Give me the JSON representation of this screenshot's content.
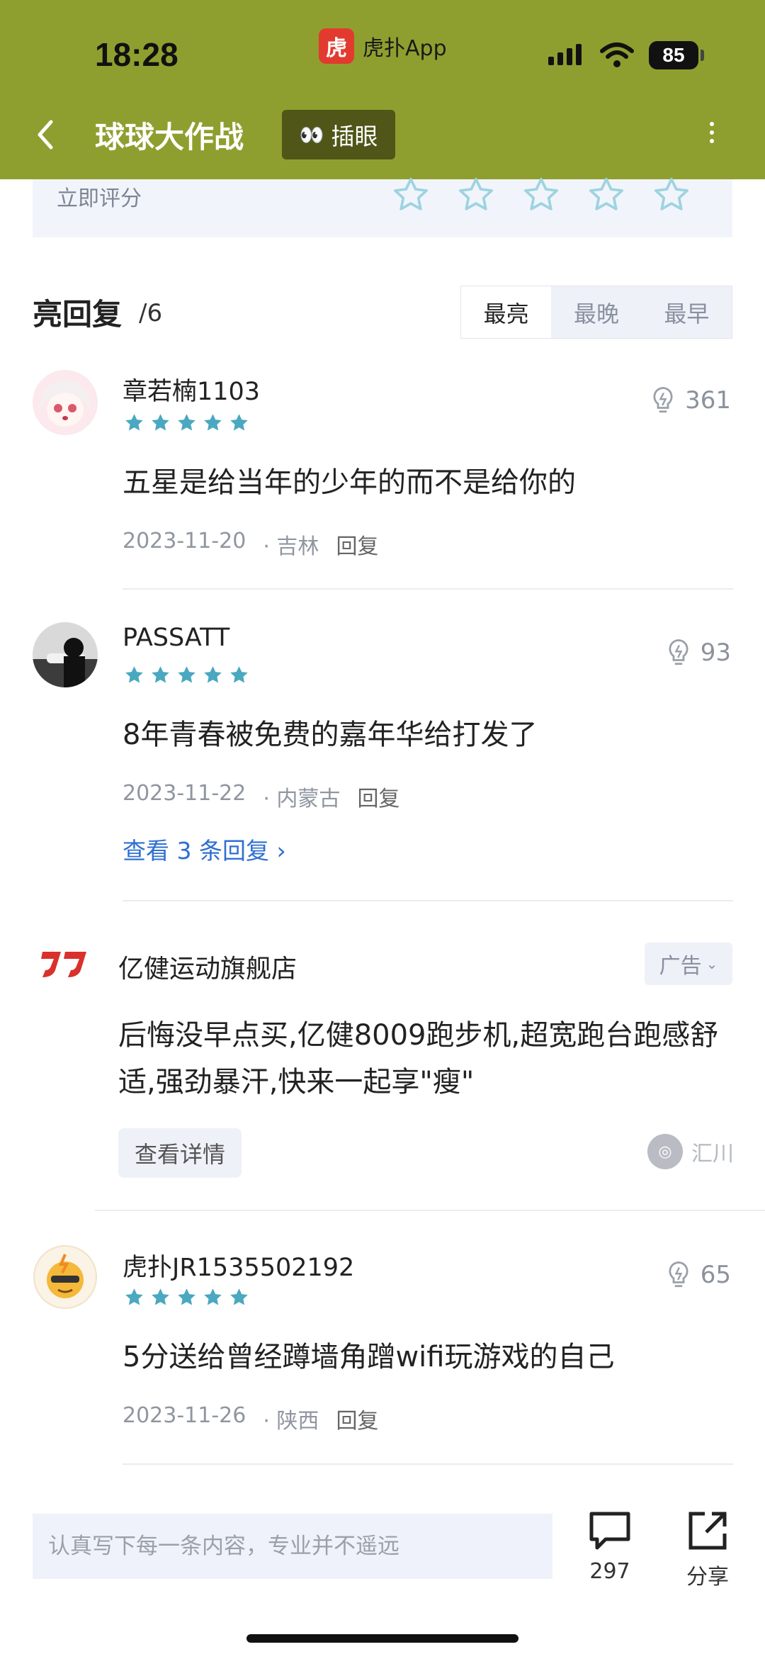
{
  "status_bar": {
    "time": "18:28",
    "app_name": "虎扑App",
    "app_logo_glyph": "虎",
    "battery": "85"
  },
  "header": {
    "title": "球球大作战",
    "peek_label": "插眼",
    "peek_icon": "👀",
    "bg_color": "#8f9f2f"
  },
  "rating": {
    "label": "立即评分",
    "star_count": 5,
    "star_color": "#5bb8d0"
  },
  "section": {
    "title": "亮回复",
    "count": "/6",
    "sort_tabs": [
      "最亮",
      "最晚",
      "最早"
    ],
    "active_tab": "最亮"
  },
  "replies": [
    {
      "username": "章若楠1103",
      "stars": 5,
      "likes": "361",
      "content": "五星是给当年的少年的而不是给你的",
      "date": "2023-11-20",
      "location": "· 吉林",
      "reply_label": "回复"
    },
    {
      "username": "PASSATT",
      "stars": 5,
      "likes": "93",
      "content": "8年青春被免费的嘉年华给打发了",
      "date": "2023-11-22",
      "location": "· 内蒙古",
      "reply_label": "回复",
      "view_more": "查看 3 条回复"
    },
    {
      "username": "虎扑JR1535502192",
      "stars": 5,
      "likes": "65",
      "content": "5分送给曾经蹲墙角蹭wifi玩游戏的自己",
      "date": "2023-11-26",
      "location": "· 陕西",
      "reply_label": "回复"
    }
  ],
  "ad": {
    "brand": "亿健运动旗舰店",
    "tag": "广告",
    "body": "后悔没早点买,亿健8009跑步机,超宽跑台跑感舒适,强劲暴汗,快来一起享\"瘦\"",
    "button": "查看详情",
    "source": "汇川"
  },
  "bottom_bar": {
    "input_placeholder": "认真写下每一条内容，专业并不遥远",
    "comment_count": "297",
    "share_label": "分享"
  }
}
